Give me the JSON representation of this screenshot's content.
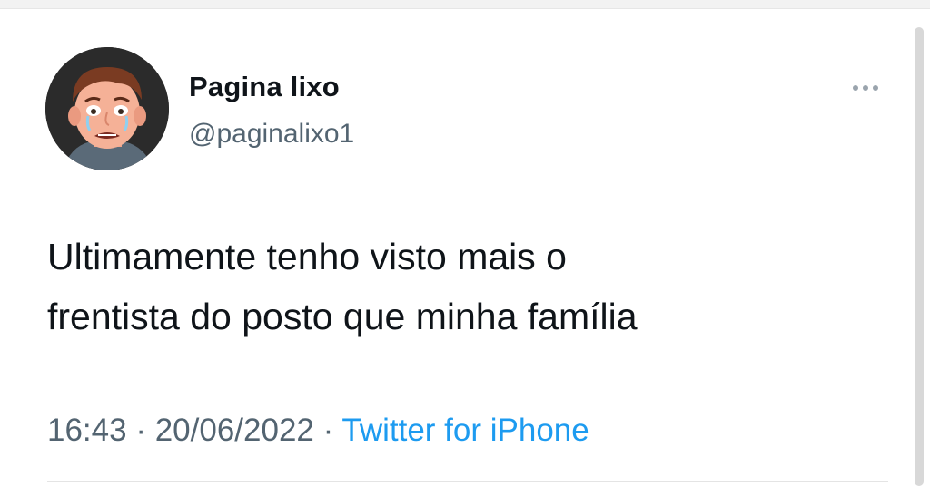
{
  "tweet": {
    "author": {
      "display_name": "Pagina lixo",
      "handle": "@paginalixo1",
      "avatar_icon": "crying-man-avatar"
    },
    "more_icon": "ellipsis-icon",
    "text_lines": [
      "Ultimamente tenho visto mais o",
      "frentista do posto que minha família"
    ],
    "time": "16:43",
    "separator": "·",
    "date": "20/06/2022",
    "source": "Twitter for iPhone"
  },
  "colors": {
    "text": "#0f1419",
    "secondary": "#536471",
    "link": "#1d9bf0",
    "background": "#ffffff"
  }
}
